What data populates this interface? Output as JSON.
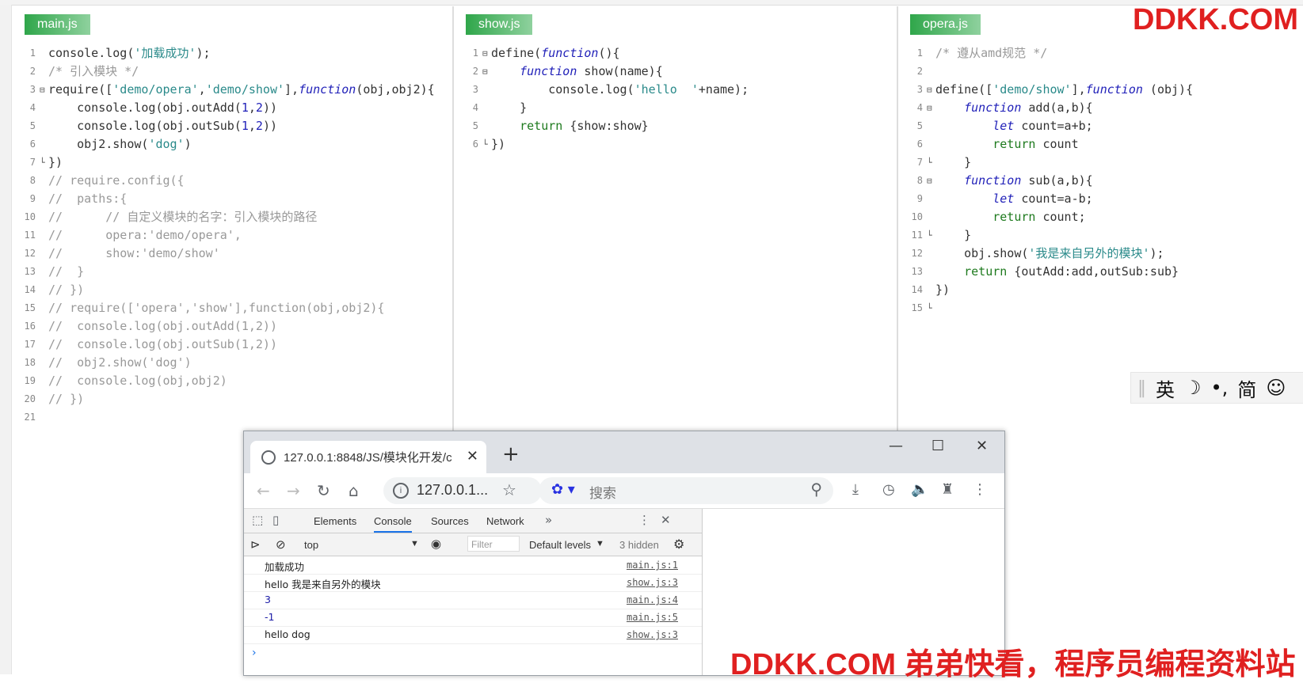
{
  "watermarks": {
    "top": "DDKK.COM",
    "bottom": "DDKK.COM 弟弟快看，程序员编程资料站"
  },
  "ime_bar": {
    "items": [
      "英",
      "☽",
      "•,",
      "简",
      "☺"
    ]
  },
  "editor": {
    "panes": [
      {
        "tab": "main.js",
        "lines": [
          {
            "n": "1",
            "fold": "",
            "segs": [
              [
                "t",
                "console.log("
              ],
              [
                "s",
                "'加载成功'"
              ],
              [
                "t",
                ");"
              ]
            ]
          },
          {
            "n": "2",
            "fold": "",
            "segs": [
              [
                "c",
                "/* 引入模块 */"
              ]
            ]
          },
          {
            "n": "3",
            "fold": "⊟",
            "segs": [
              [
                "t",
                "require(["
              ],
              [
                "s",
                "'demo/opera'"
              ],
              [
                "t",
                ","
              ],
              [
                "s",
                "'demo/show'"
              ],
              [
                "t",
                "],"
              ],
              [
                "k",
                "function"
              ],
              [
                "t",
                "(obj,obj2){"
              ]
            ]
          },
          {
            "n": "4",
            "fold": "",
            "segs": [
              [
                "t",
                "    console.log(obj.outAdd("
              ],
              [
                "n",
                "1"
              ],
              [
                "t",
                ","
              ],
              [
                "n",
                "2"
              ],
              [
                "t",
                "))"
              ]
            ]
          },
          {
            "n": "5",
            "fold": "",
            "segs": [
              [
                "t",
                "    console.log(obj.outSub("
              ],
              [
                "n",
                "1"
              ],
              [
                "t",
                ","
              ],
              [
                "n",
                "2"
              ],
              [
                "t",
                "))"
              ]
            ]
          },
          {
            "n": "6",
            "fold": "",
            "segs": [
              [
                "t",
                "    obj2.show("
              ],
              [
                "s",
                "'dog'"
              ],
              [
                "t",
                ")"
              ]
            ]
          },
          {
            "n": "7",
            "fold": "└",
            "segs": [
              [
                "t",
                "})"
              ]
            ]
          },
          {
            "n": "8",
            "fold": "",
            "segs": [
              [
                "c",
                "// require.config({"
              ]
            ]
          },
          {
            "n": "9",
            "fold": "",
            "segs": [
              [
                "c",
                "//  paths:{"
              ]
            ]
          },
          {
            "n": "10",
            "fold": "",
            "segs": [
              [
                "c",
                "//      // 自定义模块的名字：引入模块的路径"
              ]
            ]
          },
          {
            "n": "11",
            "fold": "",
            "segs": [
              [
                "c",
                "//      opera:'demo/opera',"
              ]
            ]
          },
          {
            "n": "12",
            "fold": "",
            "segs": [
              [
                "c",
                "//      show:'demo/show'"
              ]
            ]
          },
          {
            "n": "13",
            "fold": "",
            "segs": [
              [
                "c",
                "//  }"
              ]
            ]
          },
          {
            "n": "14",
            "fold": "",
            "segs": [
              [
                "c",
                "// })"
              ]
            ]
          },
          {
            "n": "15",
            "fold": "",
            "segs": [
              [
                "c",
                "// require(['opera','show'],function(obj,obj2){"
              ]
            ]
          },
          {
            "n": "16",
            "fold": "",
            "segs": [
              [
                "c",
                "//  console.log(obj.outAdd(1,2))"
              ]
            ]
          },
          {
            "n": "17",
            "fold": "",
            "segs": [
              [
                "c",
                "//  console.log(obj.outSub(1,2))"
              ]
            ]
          },
          {
            "n": "18",
            "fold": "",
            "segs": [
              [
                "c",
                "//  obj2.show('dog')"
              ]
            ]
          },
          {
            "n": "19",
            "fold": "",
            "segs": [
              [
                "c",
                "//  console.log(obj,obj2)"
              ]
            ]
          },
          {
            "n": "20",
            "fold": "",
            "segs": [
              [
                "c",
                "// })"
              ]
            ]
          },
          {
            "n": "21",
            "fold": "",
            "segs": []
          }
        ]
      },
      {
        "tab": "show.js",
        "lines": [
          {
            "n": "1",
            "fold": "⊟",
            "segs": [
              [
                "t",
                "define("
              ],
              [
                "k",
                "function"
              ],
              [
                "t",
                "(){"
              ]
            ]
          },
          {
            "n": "2",
            "fold": "⊟",
            "segs": [
              [
                "t",
                "    "
              ],
              [
                "k",
                "function"
              ],
              [
                "t",
                " show(name){"
              ]
            ]
          },
          {
            "n": "3",
            "fold": "",
            "segs": [
              [
                "t",
                "        console.log("
              ],
              [
                "s",
                "'hello  '"
              ],
              [
                "t",
                "+name);"
              ]
            ]
          },
          {
            "n": "4",
            "fold": "",
            "segs": [
              [
                "t",
                "    }"
              ]
            ]
          },
          {
            "n": "5",
            "fold": "",
            "segs": [
              [
                "t",
                "    "
              ],
              [
                "g",
                "return"
              ],
              [
                "t",
                " {show:show}"
              ]
            ]
          },
          {
            "n": "6",
            "fold": "└",
            "segs": [
              [
                "t",
                "})"
              ]
            ]
          }
        ]
      },
      {
        "tab": "opera.js",
        "lines": [
          {
            "n": "1",
            "fold": "",
            "segs": [
              [
                "c",
                "/* 遵从amd规范 */"
              ]
            ]
          },
          {
            "n": "2",
            "fold": "",
            "segs": []
          },
          {
            "n": "3",
            "fold": "⊟",
            "segs": [
              [
                "t",
                "define(["
              ],
              [
                "s",
                "'demo/show'"
              ],
              [
                "t",
                "],"
              ],
              [
                "k",
                "function"
              ],
              [
                "t",
                " (obj){"
              ]
            ]
          },
          {
            "n": "4",
            "fold": "⊟",
            "segs": [
              [
                "t",
                "    "
              ],
              [
                "k",
                "function"
              ],
              [
                "t",
                " add(a,b){"
              ]
            ]
          },
          {
            "n": "5",
            "fold": "",
            "segs": [
              [
                "t",
                "        "
              ],
              [
                "k",
                "let"
              ],
              [
                "t",
                " count=a+b;"
              ]
            ]
          },
          {
            "n": "6",
            "fold": "",
            "segs": [
              [
                "t",
                "        "
              ],
              [
                "g",
                "return"
              ],
              [
                "t",
                " count"
              ]
            ]
          },
          {
            "n": "7",
            "fold": "└",
            "segs": [
              [
                "t",
                "    }"
              ]
            ]
          },
          {
            "n": "8",
            "fold": "⊟",
            "segs": [
              [
                "t",
                "    "
              ],
              [
                "k",
                "function"
              ],
              [
                "t",
                " sub(a,b){"
              ]
            ]
          },
          {
            "n": "9",
            "fold": "",
            "segs": [
              [
                "t",
                "        "
              ],
              [
                "k",
                "let"
              ],
              [
                "t",
                " count=a-b;"
              ]
            ]
          },
          {
            "n": "10",
            "fold": "",
            "segs": [
              [
                "t",
                "        "
              ],
              [
                "g",
                "return"
              ],
              [
                "t",
                " count;"
              ]
            ]
          },
          {
            "n": "11",
            "fold": "└",
            "segs": [
              [
                "t",
                "    }"
              ]
            ]
          },
          {
            "n": "12",
            "fold": "",
            "segs": [
              [
                "t",
                "    obj.show("
              ],
              [
                "s",
                "'我是来自另外的模块'"
              ],
              [
                "t",
                ");"
              ]
            ]
          },
          {
            "n": "13",
            "fold": "",
            "segs": [
              [
                "t",
                "    "
              ],
              [
                "g",
                "return"
              ],
              [
                "t",
                " {outAdd:add,outSub:sub}"
              ]
            ]
          },
          {
            "n": "14",
            "fold": "",
            "segs": [
              [
                "t",
                "})"
              ]
            ]
          },
          {
            "n": "15",
            "fold": "└",
            "segs": []
          }
        ]
      }
    ]
  },
  "browser": {
    "tab_title": "127.0.0.1:8848/JS/模块化开发/c",
    "address": "127.0.0.1...",
    "search_placeholder": "搜索",
    "devtools": {
      "tabs": [
        "Elements",
        "Console",
        "Sources",
        "Network"
      ],
      "active_tab": "Console",
      "context": "top",
      "filter_placeholder": "Filter",
      "levels": "Default levels",
      "hidden": "3 hidden",
      "messages": [
        {
          "text": "加载成功",
          "source": "main.js:1",
          "numeric": false
        },
        {
          "text": "hello  我是来自另外的模块",
          "source": "show.js:3",
          "numeric": false
        },
        {
          "text": "3",
          "source": "main.js:4",
          "numeric": true
        },
        {
          "text": "-1",
          "source": "main.js:5",
          "numeric": true
        },
        {
          "text": "hello  dog",
          "source": "show.js:3",
          "numeric": false
        }
      ]
    }
  }
}
